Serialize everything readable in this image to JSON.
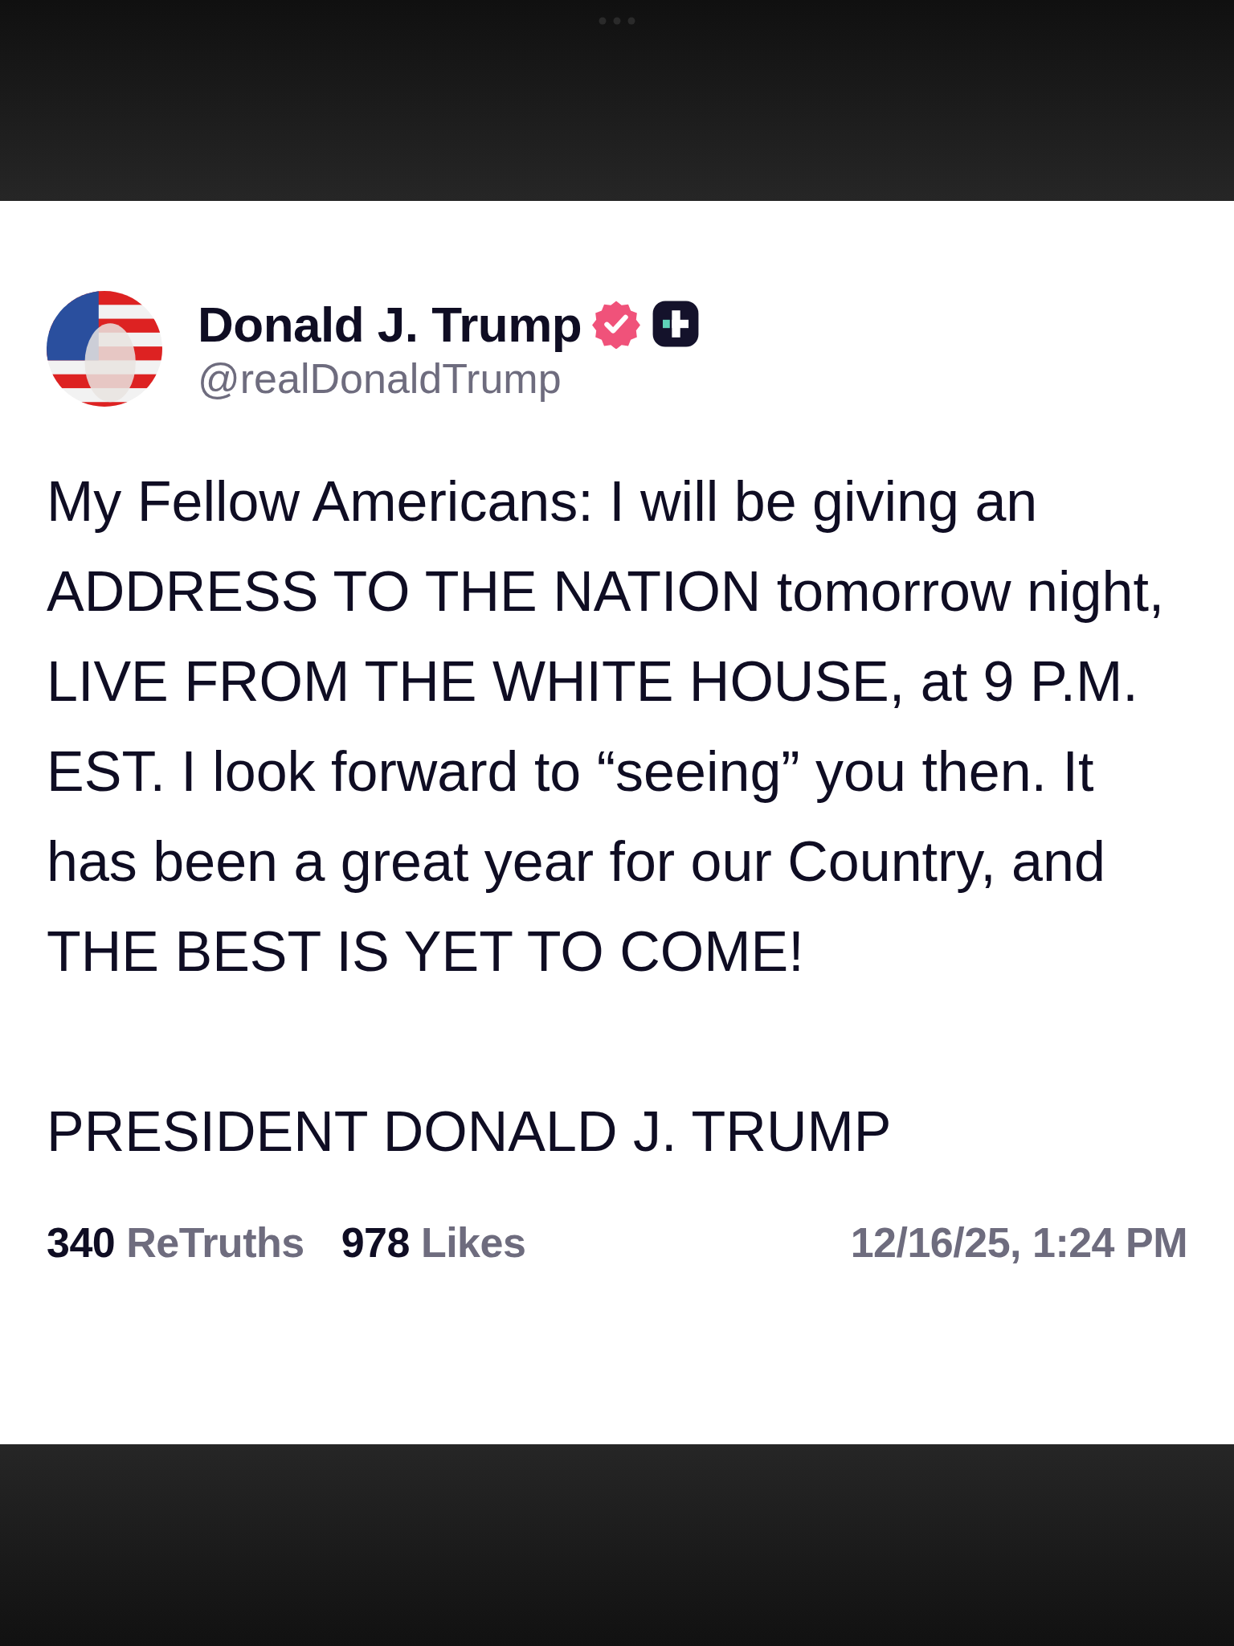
{
  "post": {
    "author": {
      "name": "Donald J. Trump",
      "verified": true,
      "handle": "@realDonaldTrump"
    },
    "paragraphs": [
      "My Fellow Americans: I will be giving an ADDRESS TO THE NATION tomorrow night, LIVE FROM THE WHITE HOUSE, at 9 P.M. EST. I look forward to “seeing” you then. It has been a great year for our Country, and THE BEST IS YET TO COME!",
      "PRESIDENT DONALD J. TRUMP"
    ],
    "stats": [
      {
        "count": "340",
        "label": "ReTruths"
      },
      {
        "count": "978",
        "label": "Likes"
      }
    ],
    "timestamp": "12/16/25, 1:24 PM"
  }
}
